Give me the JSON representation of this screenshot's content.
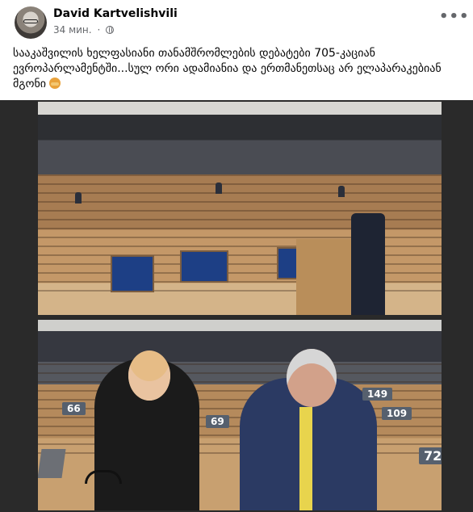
{
  "post": {
    "author": "David Kartvelishvili",
    "time": "34 мин.",
    "separator": "·",
    "privacy_icon": "globe-icon",
    "more_icon": "more-horizontal-icon",
    "more_label": "•••",
    "text": "სააკაშვილის ხელფასიანი თანამშრომლების დებატები 705-კაციან ევროპარლამენტში...სულ ორი ადამიანია და ერთმანეთსაც არ ელაპარაკებიან მგონი",
    "emoji_icon": "person-shrugging-emoji-icon"
  },
  "media": {
    "name_plates": [
      "66",
      "69",
      "149",
      "109",
      "72"
    ]
  }
}
